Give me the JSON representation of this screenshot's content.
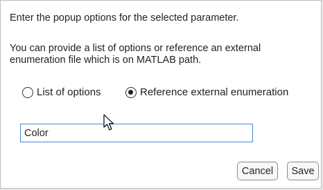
{
  "dialog": {
    "instruction": "Enter the popup options for the selected parameter.",
    "note": "You can provide a list of options or reference an external enumeration file which is on MATLAB path.",
    "options": [
      {
        "label": "List of options",
        "selected": false
      },
      {
        "label": "Reference external enumeration",
        "selected": true
      }
    ],
    "enumeration_input": {
      "value": "Color"
    },
    "buttons": {
      "cancel": "Cancel",
      "save": "Save"
    }
  },
  "icons": {
    "cursor": "mouse-pointer-icon"
  },
  "colors": {
    "input_border": "#3f87d8",
    "dialog_bg": "#ffffff",
    "outer_bg": "#e9e9e9"
  }
}
